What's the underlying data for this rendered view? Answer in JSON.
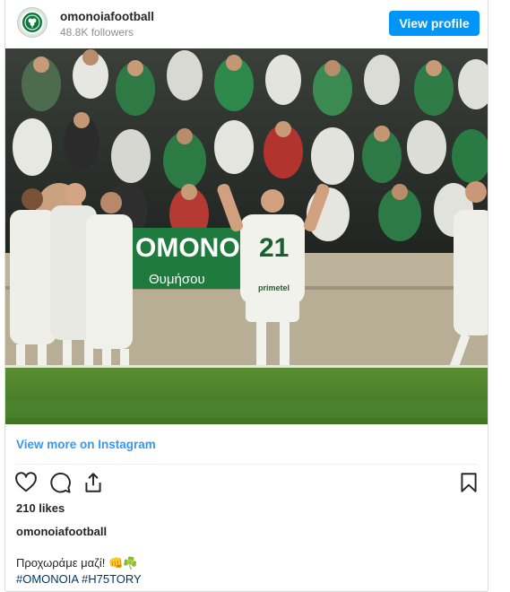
{
  "header": {
    "username": "omonoiafootball",
    "followers": "48.8K followers",
    "view_profile_label": "View profile"
  },
  "photo": {
    "banner_text": "OMONOI",
    "banner_subtext": "Θυμήσου",
    "player_number": "21",
    "shirt_sponsor": "primetel"
  },
  "view_more_label": "View more on Instagram",
  "likes": "210 likes",
  "caption": {
    "username": "omonoiafootball",
    "text": "Προχωράμε μαζί! 👊☘️",
    "hashtags": [
      "#OMONOIA",
      "#H75TORY"
    ]
  },
  "icons": {
    "like": "heart-icon",
    "comment": "comment-icon",
    "share": "share-icon",
    "save": "bookmark-icon"
  },
  "colors": {
    "accent": "#0095f6",
    "link": "#3897f0",
    "hashtag": "#00376b",
    "club_green": "#0b7a3d"
  }
}
